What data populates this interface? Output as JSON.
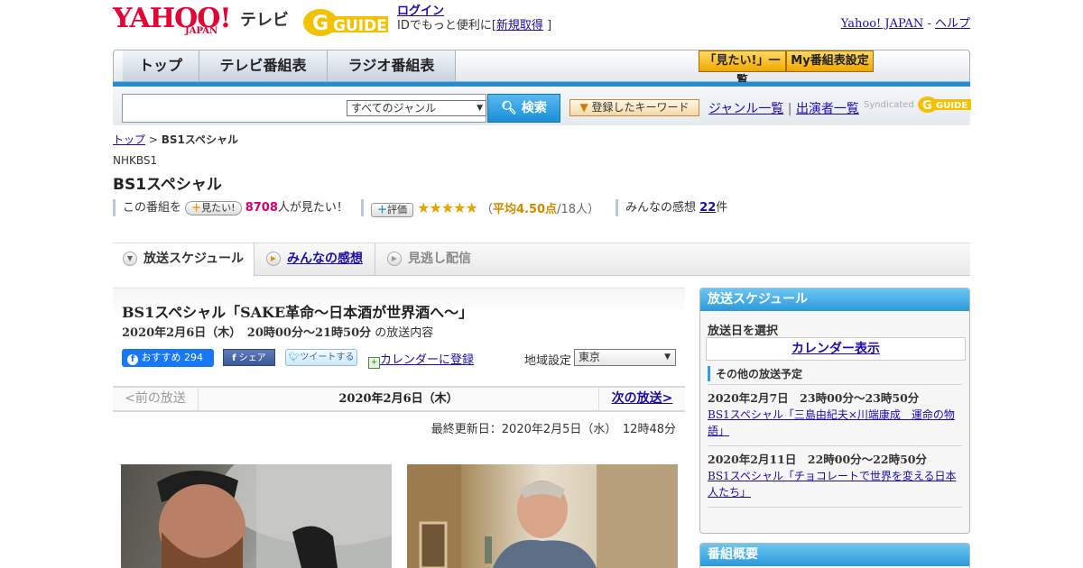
{
  "header": {
    "yahoo": "YAHOO!",
    "japan": "JAPAN",
    "tv": "テレビ",
    "gguide": "GUIDE",
    "login": "ログイン",
    "login_sub_pre": "IDでもっと便利に[",
    "signup": "新規取得",
    "login_sub_post": "]",
    "yahoo_japan_link": "Yahoo! JAPAN",
    "sep": " - ",
    "help_link": "ヘルプ"
  },
  "nav": {
    "tabs": [
      "トップ",
      "テレビ番組表",
      "ラジオ番組表"
    ],
    "btn_mitai_list": "「見たい!」一覧",
    "btn_my_table": "My番組表設定"
  },
  "search": {
    "placeholder": "",
    "genre": "すべてのジャンル",
    "button": "検索",
    "keywords_button": "登録したキーワード",
    "genre_list": "ジャンル一覧",
    "divider": "|",
    "performer_list": "出演者一覧",
    "syndicated": "Syndicated"
  },
  "breadcrumb": {
    "top": "トップ",
    "sep": " > ",
    "current": "BS1スペシャル"
  },
  "program": {
    "channel": "NHKBS1",
    "title": "BS1スペシャル",
    "mitai_prefix": "この番組を",
    "mitai_btn": "見たい!",
    "mitai_count": "8708",
    "mitai_suffix": "人が見たい！",
    "rate_btn": "評価",
    "stars": "★★★★★",
    "avg_open": "（",
    "avg": "平均4.50点",
    "avg_count": "/18人）",
    "rating": 4.5,
    "reviews_label": "みんなの感想",
    "reviews_count": "22",
    "reviews_unit": "件"
  },
  "tabs": {
    "schedule": "放送スケジュール",
    "reviews": "みんなの感想",
    "missed": "見逃し配信"
  },
  "episode": {
    "title": "BS1スペシャル「SAKE革命～日本酒が世界酒へ～」",
    "date": "2020年2月6日（木）　20時00分～21時50分",
    "date_suffix": "の放送内容",
    "fb_label": "おすすめ",
    "fb_count": "294",
    "share": "シェア",
    "tweet": "ツイートする",
    "calendar": "カレンダーに登録",
    "region_label": "地域設定",
    "region": "東京"
  },
  "pager": {
    "prev": "<前の放送",
    "current": "2020年2月6日（木）",
    "next": "次の放送>"
  },
  "updated": "最終更新日：2020年2月5日（水）　12時48分",
  "sidebar": {
    "schedule_head": "放送スケジュール",
    "pick_date": "放送日を選択",
    "calendar_btn": "カレンダー表示",
    "other_label": "その他の放送予定",
    "items": [
      {
        "time": "2020年2月7日　23時00分～23時50分",
        "title": "BS1スペシャル「三島由紀夫×川端康成　運命の物語」"
      },
      {
        "time": "2020年2月11日　22時00分～22時50分",
        "title": "BS1スペシャル「チョコレートで世界を変える日本人たち」"
      }
    ],
    "summary_head": "番組概要"
  },
  "colors": {
    "yahoo_red": "#e60033",
    "accent_blue": "#1f8ed6",
    "link": "#1a0dab",
    "gold": "#f0a800"
  }
}
